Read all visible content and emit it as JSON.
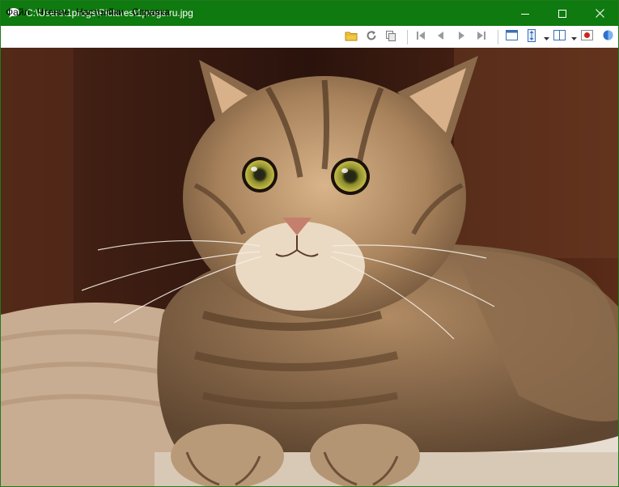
{
  "window": {
    "title": "C:\\Users\\1progs\\Pictures\\1progs.ru.jpg",
    "app_icon": "speech-bubble-icon",
    "controls": [
      "minimize-icon",
      "maximize-icon",
      "close-icon"
    ],
    "accent_color": "#0f7a0f"
  },
  "menu": {
    "items": [
      {
        "label": "Файл"
      },
      {
        "label": "Чтение"
      },
      {
        "label": "Настройки"
      },
      {
        "label": "Справка"
      }
    ]
  },
  "toolbar": {
    "icons": [
      "open-folder-icon",
      "refresh-icon",
      "copy-icon",
      "first-icon",
      "previous-icon",
      "next-icon",
      "last-icon",
      "window-icon",
      "fit-height-icon",
      "layout-icon",
      "record-icon",
      "globe-icon"
    ]
  },
  "image": {
    "subject": "cat-photo"
  }
}
